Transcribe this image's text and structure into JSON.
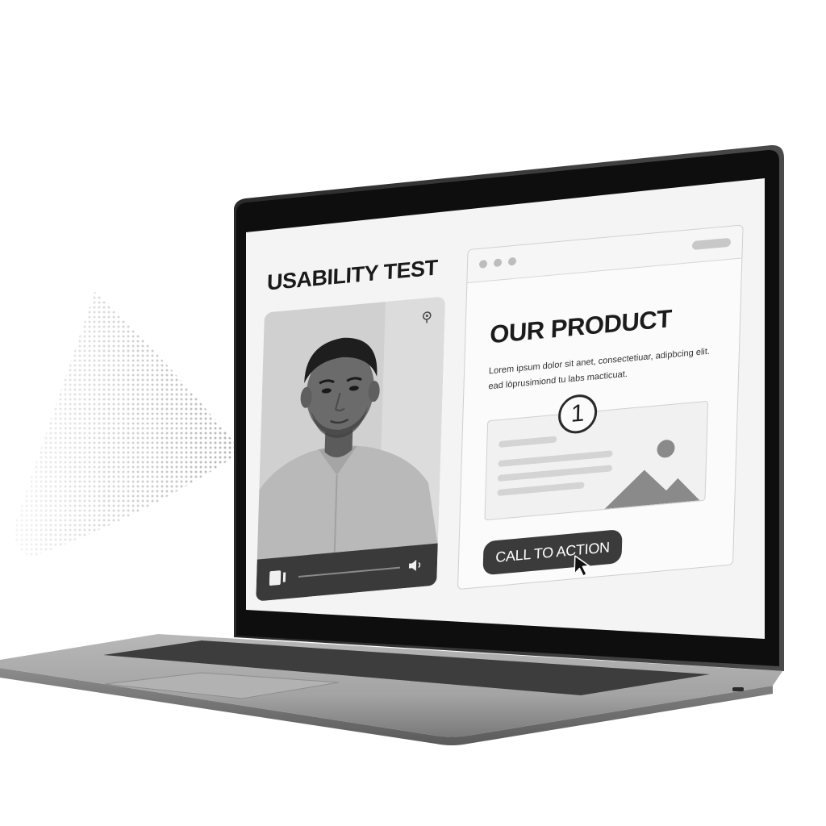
{
  "screen": {
    "title": "USABILITY TEST"
  },
  "video_player": {
    "camera_icon": "webcam-icon",
    "play_icon": "play-icon",
    "volume_icon": "volume-icon",
    "progress": 0.0
  },
  "browser": {
    "window_dots": 3,
    "heading": "OUR PRODUCT",
    "body_text": "Lorem ipsum dolor sit anet, consectetiuar, adipbcing elit. ead lòprusimiond tu labs macticuat.",
    "step_number": "1",
    "cta_label": "CALL TO ACTION",
    "image_icon": "mountain-image-icon",
    "cursor_icon": "cursor-arrow-icon"
  },
  "colors": {
    "background": "#ffffff",
    "laptop_body": "#9b9b9b",
    "bezel": "#0e0e0e",
    "screen": "#f4f4f4",
    "button": "#3b3b3b",
    "accent_dark": "#1c1c1c"
  }
}
